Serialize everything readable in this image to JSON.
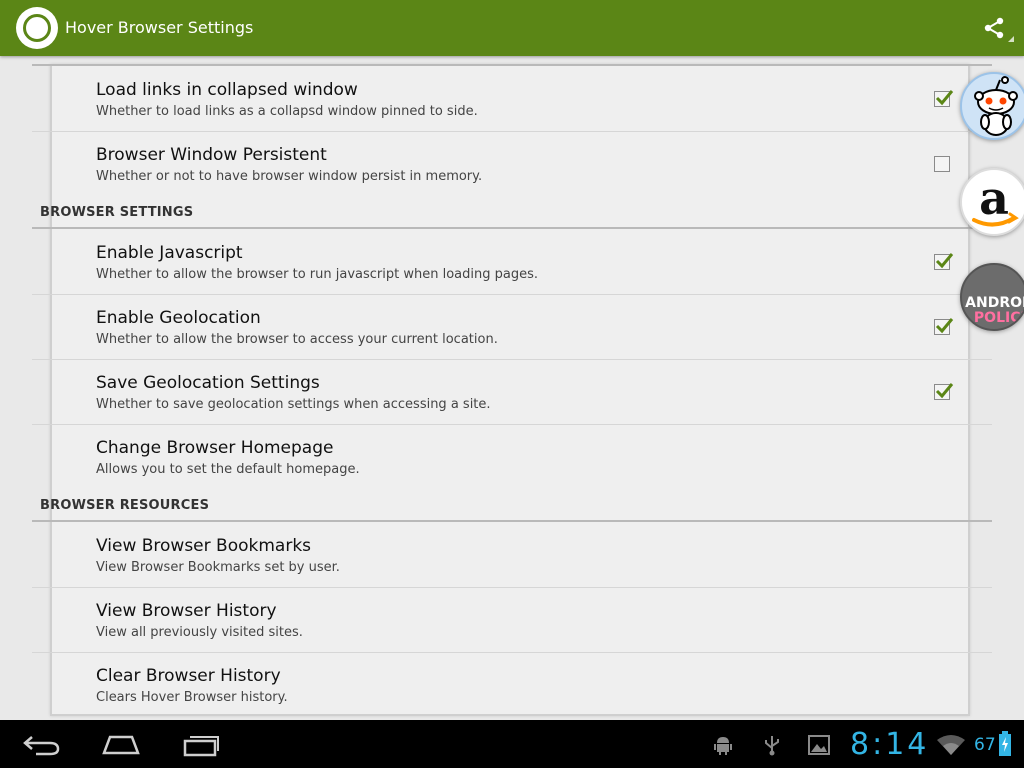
{
  "app_bar": {
    "title": "Hover Browser Settings",
    "logo_icon": "hover-browser-logo-icon",
    "action_icon": "share-icon",
    "color": "#5b8616"
  },
  "settings": {
    "load_links": {
      "title": "Load links in collapsed window",
      "summary": "Whether to load links as a collapsd window pinned to side.",
      "checked": true
    },
    "persistent": {
      "title": "Browser Window Persistent",
      "summary": "Whether or not to have browser window persist in memory.",
      "checked": false
    },
    "browser_settings_header": "BROWSER SETTINGS",
    "javascript": {
      "title": "Enable Javascript",
      "summary": "Whether to allow the browser to run javascript when loading pages.",
      "checked": true
    },
    "geolocation": {
      "title": "Enable Geolocation",
      "summary": "Whether to allow the browser to access your current location.",
      "checked": true
    },
    "save_geolocation": {
      "title": "Save Geolocation Settings",
      "summary": "Whether to save geolocation settings when accessing a site.",
      "checked": true
    },
    "homepage": {
      "title": "Change Browser Homepage",
      "summary": "Allows you to set the default homepage."
    },
    "browser_resources_header": "BROWSER RESOURCES",
    "bookmarks": {
      "title": "View Browser Bookmarks",
      "summary": "View Browser Bookmarks set by user."
    },
    "history": {
      "title": "View Browser History",
      "summary": "View all previously visited sites."
    },
    "clear_history": {
      "title": "Clear Browser History",
      "summary": "Clears Hover Browser history."
    }
  },
  "bubbles": {
    "reddit_icon": "reddit-alien-icon",
    "amazon_icon": "amazon-a-icon",
    "ap_lines": [
      "ANDROID",
      "POLICE"
    ]
  },
  "system_bar": {
    "time": "8:14",
    "battery": "67",
    "accent": "#33b5e5",
    "icons": [
      "back-icon",
      "home-icon",
      "recents-icon",
      "android-debug-icon",
      "usb-icon",
      "gallery-icon",
      "wifi-icon",
      "battery-icon"
    ]
  }
}
